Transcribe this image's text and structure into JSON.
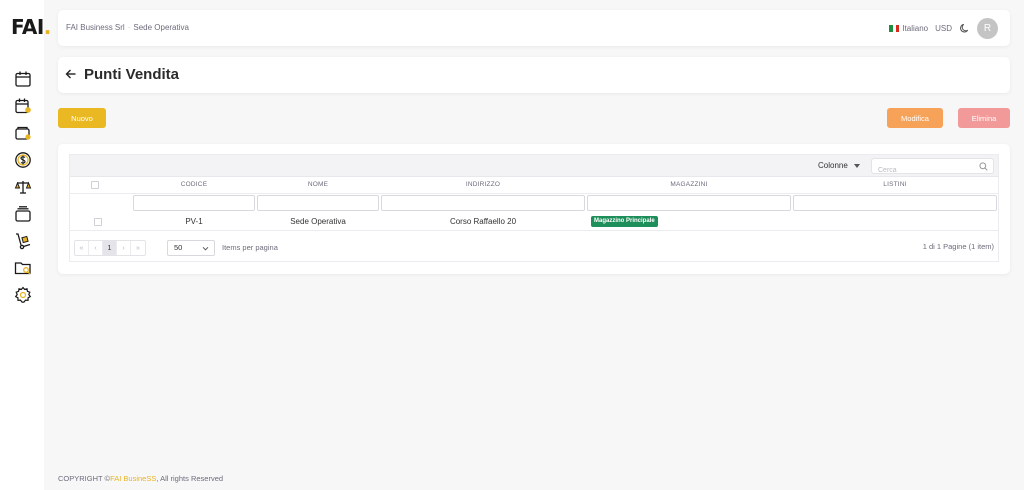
{
  "logo": {
    "text": "FAI",
    "dot": "."
  },
  "colors": {
    "accent": "#e9b822",
    "edit": "#f7a259",
    "delete": "#f29a9a",
    "badge": "#1e8e5a",
    "sidebar_icon": "#1a1a1a"
  },
  "sidebar": {
    "items": [
      {
        "icon": "calendar-icon"
      },
      {
        "icon": "calendar-user-icon"
      },
      {
        "icon": "wallet-icon"
      },
      {
        "icon": "dollar-coin-icon"
      },
      {
        "icon": "scale-icon"
      },
      {
        "icon": "cards-stack-icon"
      },
      {
        "icon": "hand-truck-icon"
      },
      {
        "icon": "folder-search-icon"
      },
      {
        "icon": "settings-gear-icon"
      }
    ]
  },
  "header": {
    "company": "FAI Business Srl",
    "location": "Sede Operativa",
    "language": "Italiano",
    "currency": "USD",
    "avatar_initial": "R"
  },
  "page": {
    "title": "Punti Vendita"
  },
  "actions": {
    "new": "Nuovo",
    "edit": "Modifica",
    "delete": "Elimina"
  },
  "grid": {
    "columns_label": "Colonne",
    "search_placeholder": "Cerca",
    "headers": {
      "codice": "CODICE",
      "nome": "NOME",
      "indirizzo": "INDIRIZZO",
      "magazzini": "MAGAZZINI",
      "listini": "LISTINI"
    },
    "rows": [
      {
        "codice": "PV-1",
        "nome": "Sede Operativa",
        "indirizzo": "Corso Raffaello 20",
        "magazzini": "Magazzino Principale",
        "listini": ""
      }
    ],
    "pager": {
      "first": "«",
      "prev": "‹",
      "current": "1",
      "next": "›",
      "last": "»",
      "per_page": "50",
      "per_page_label": "Items per pagina",
      "info": "1 di 1 Pagine (1 item)"
    }
  },
  "footer": {
    "prefix": "COPYRIGHT ©",
    "brand": "FAI BusineSS",
    "suffix": ", All rights Reserved"
  }
}
